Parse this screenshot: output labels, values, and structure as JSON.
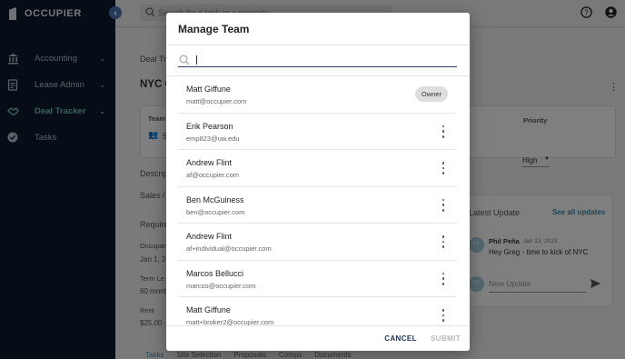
{
  "app": {
    "brand": "OCCUPIER"
  },
  "sidebar": {
    "items": [
      {
        "label": "Accounting",
        "icon": "bank-icon",
        "has_submenu": true,
        "active": false
      },
      {
        "label": "Lease Admin",
        "icon": "document-icon",
        "has_submenu": true,
        "active": false
      },
      {
        "label": "Deal Tracker",
        "icon": "handshake-icon",
        "has_submenu": true,
        "active": true
      },
      {
        "label": "Tasks",
        "icon": "check-circle-icon",
        "has_submenu": false,
        "active": false
      }
    ]
  },
  "topbar": {
    "search_placeholder": "Search for a task or a property"
  },
  "background_page": {
    "breadcrumb": "Deal Tr",
    "title": "NYC C",
    "team_label": "Team",
    "team_count": "5",
    "priority_label": "Priority",
    "priority_value": "High",
    "description_label": "Descrip",
    "sales_label": "Sales /",
    "requirements_label": "Require",
    "occupancy_label": "Occupan",
    "occupancy_value": "Jan 1, 2",
    "term_label": "Term Le",
    "term_value": "60 mont",
    "rent_label": "Rent",
    "rent_value": "$25.00 -",
    "latest_update": {
      "heading": "Latest Update",
      "see_all": "See all updates",
      "author": "Phil Peña",
      "date": "Jan 13, 2023",
      "message": "Hey Greg - time to kick of NYC",
      "author_initials": "PP",
      "my_initials": "AF",
      "new_update_placeholder": "New Update"
    },
    "tabs": [
      "Tasks",
      "Site Selection",
      "Proposals",
      "Comps",
      "Documents"
    ]
  },
  "modal": {
    "title": "Manage Team",
    "search": {
      "value": "",
      "placeholder": ""
    },
    "members": [
      {
        "name": "Matt Giffune",
        "email": "matt@occupier.com",
        "badge": "Owner"
      },
      {
        "name": "Erik Pearson",
        "email": "emp823@uw.edu",
        "badge": ""
      },
      {
        "name": "Andrew Flint",
        "email": "af@occupier.com",
        "badge": ""
      },
      {
        "name": "Ben McGuiness",
        "email": "ben@occupier.com",
        "badge": ""
      },
      {
        "name": "Andrew Flint",
        "email": "af+individual@occupier.com",
        "badge": ""
      },
      {
        "name": "Marcos Bellucci",
        "email": "marcos@occupier.com",
        "badge": ""
      },
      {
        "name": "Matt Giffune",
        "email": "matt+broker2@occupier.com",
        "badge": ""
      }
    ],
    "cancel_label": "CANCEL",
    "submit_label": "SUBMIT"
  },
  "colors": {
    "sidebar_bg": "#0d1a2e",
    "active_nav": "#6fc4b0",
    "primary_dark": "#1e3350",
    "link_teal": "#3d8aa8"
  }
}
